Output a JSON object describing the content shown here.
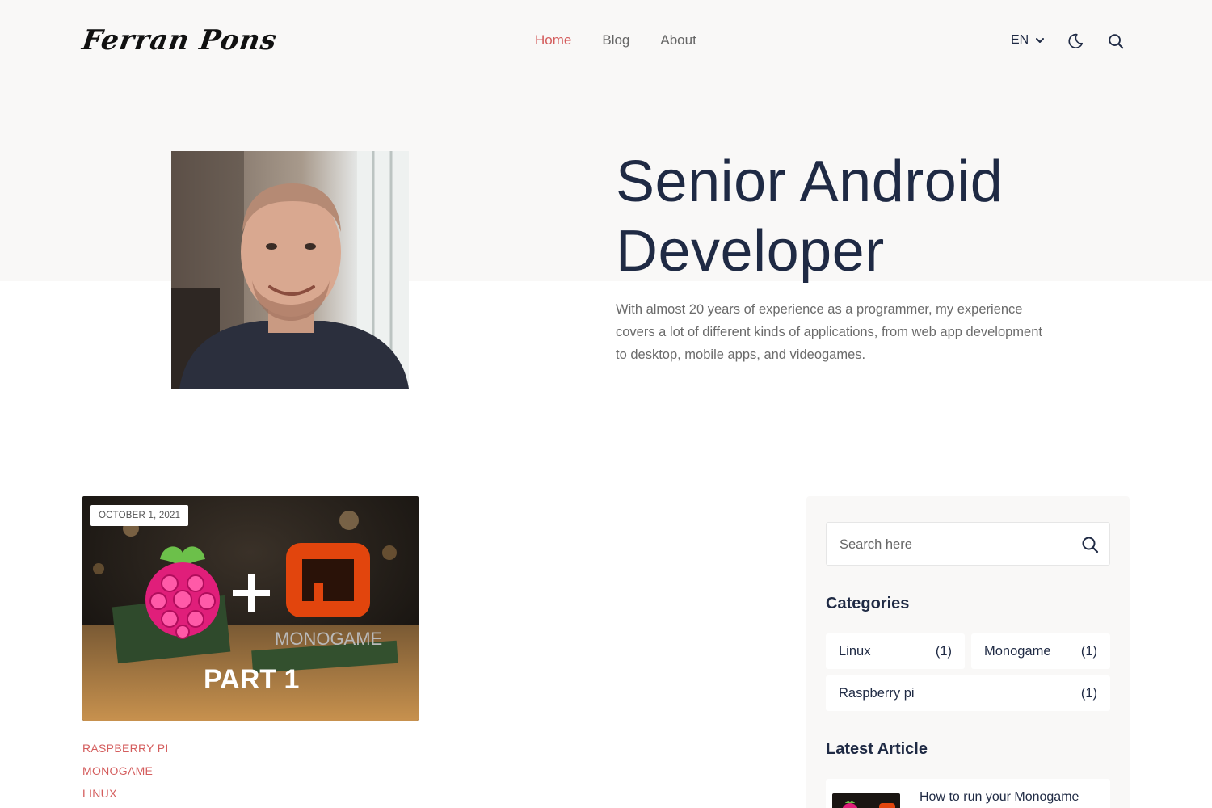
{
  "header": {
    "logo": "Ferran Pons",
    "nav": [
      "Home",
      "Blog",
      "About"
    ],
    "active_nav": "Home",
    "language": "EN"
  },
  "hero": {
    "title": "Senior Android Developer",
    "description": "With almost 20 years of experience as a programmer, my experience covers a lot of different kinds of applications, from web app development to desktop, mobile apps, and videogames."
  },
  "post": {
    "date": "OCTOBER 1, 2021",
    "image_text": "PART 1",
    "image_brand": "MONOGAME",
    "tags": [
      "RASPBERRY PI",
      "MONOGAME",
      "LINUX"
    ]
  },
  "sidebar": {
    "search_placeholder": "Search here",
    "categories_title": "Categories",
    "categories": [
      {
        "name": "Linux",
        "count": "(1)"
      },
      {
        "name": "Monogame",
        "count": "(1)"
      },
      {
        "name": "Raspberry pi",
        "count": "(1)"
      }
    ],
    "latest_title": "Latest Article",
    "latest_article": "How to run your Monogame"
  },
  "colors": {
    "accent": "#d45d5d",
    "heading": "#1f2a44",
    "hero_bg": "#f9f8f7"
  }
}
